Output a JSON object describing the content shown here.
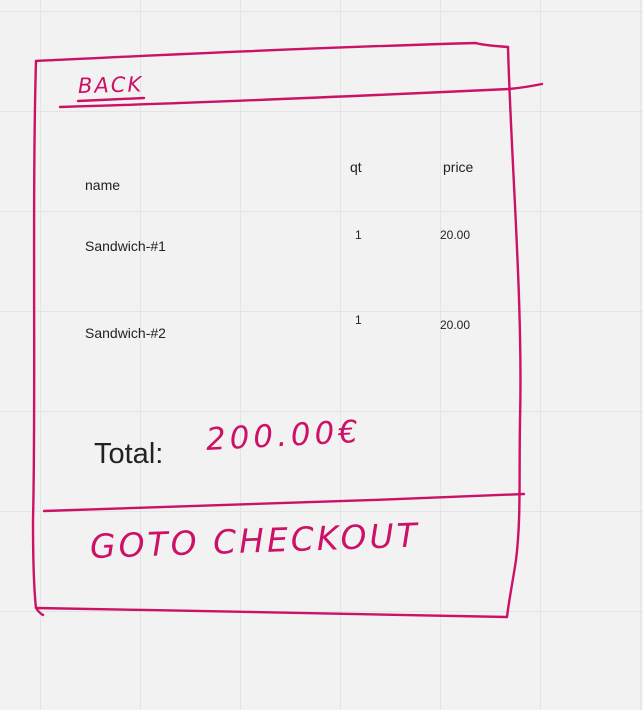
{
  "nav": {
    "back_label": "BACK"
  },
  "cart_table": {
    "columns": {
      "name": "name",
      "qt": "qt",
      "price": "price"
    },
    "rows": [
      {
        "name": "Sandwich-#1",
        "qt": "1",
        "price": "20.00"
      },
      {
        "name": "Sandwich-#2",
        "qt": "1",
        "price": "20.00"
      }
    ]
  },
  "summary": {
    "total_label": "Total:",
    "total_value": "200.00€"
  },
  "actions": {
    "checkout_label": "GOTO CHECKOUT"
  },
  "colors": {
    "sketch_stroke": "#cc1166",
    "background": "#f2f2f2",
    "grid": "#e4e4e4",
    "text": "#222222"
  }
}
